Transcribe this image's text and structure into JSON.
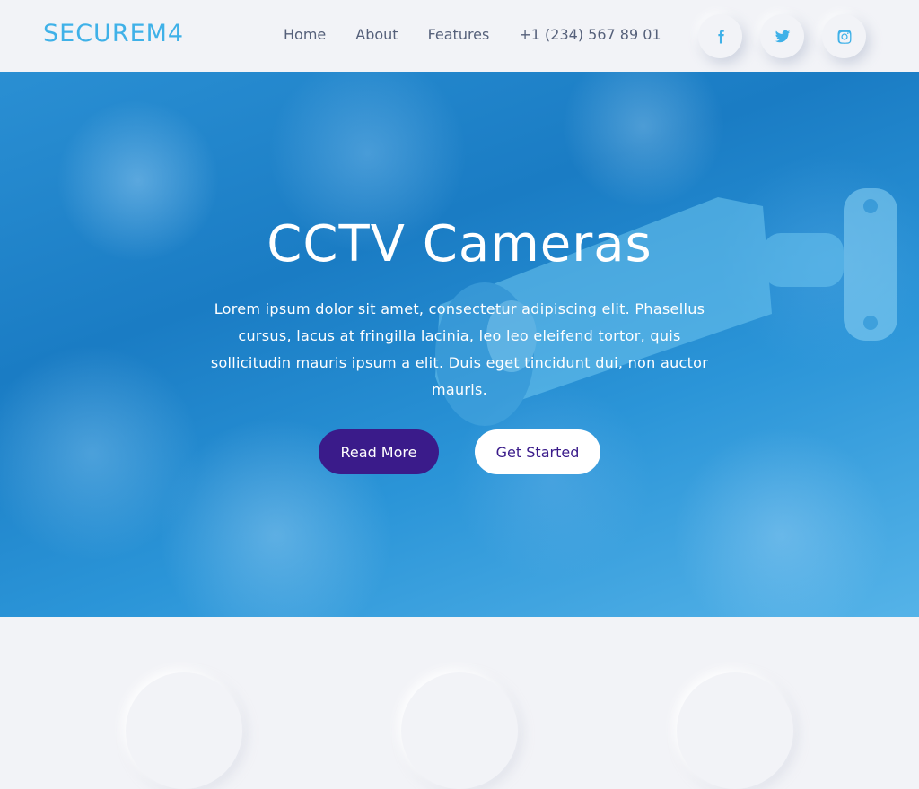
{
  "brand": {
    "logo_text": "SECUREM4",
    "accent": "#3fb1e8",
    "primary": "#3a1b8a"
  },
  "nav": {
    "items": [
      {
        "label": "Home"
      },
      {
        "label": "About"
      },
      {
        "label": "Features"
      },
      {
        "label": "+1 (234) 567 89 01"
      }
    ]
  },
  "socials": [
    {
      "name": "facebook-icon"
    },
    {
      "name": "twitter-icon"
    },
    {
      "name": "instagram-icon"
    }
  ],
  "hero": {
    "title": "CCTV Cameras",
    "text": "Lorem ipsum dolor sit amet, consectetur adipiscing elit. Phasellus cursus, lacus at fringilla lacinia, leo leo eleifend tortor, quis sollicitudin mauris ipsum a elit. Duis eget tincidunt dui, non auctor mauris.",
    "primary_button": "Read More",
    "secondary_button": "Get Started"
  }
}
